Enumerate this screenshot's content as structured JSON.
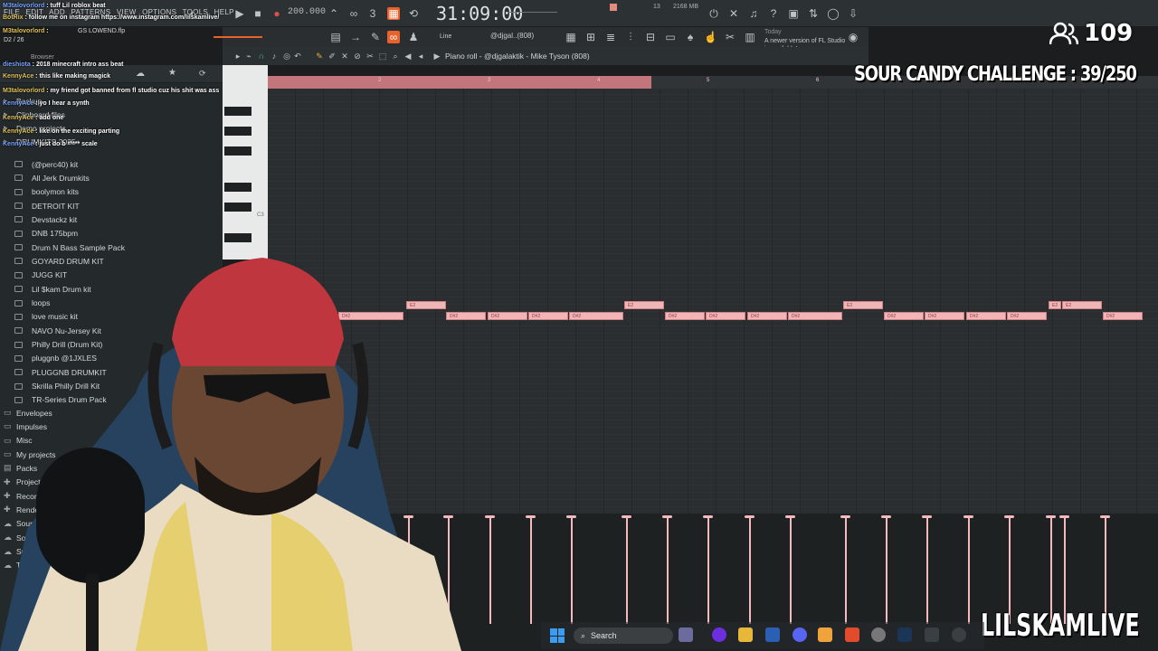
{
  "menu": [
    "FILE",
    "EDIT",
    "ADD",
    "PATTERNS",
    "VIEW",
    "OPTIONS",
    "TOOLS",
    "HELP"
  ],
  "transport": {
    "tempo": "200.000",
    "timer": "31:09:00",
    "cpu": "13",
    "memory": "2168 MB"
  },
  "update_hint": {
    "today": "Today",
    "text": "A newer version of FL Studio is available!"
  },
  "snap_mode": "Line",
  "pattern_selector": "@djgal..(808)",
  "piano_roll_title": "Piano roll - @djgalaktik - Mike Tyson (808)",
  "browser": {
    "label": "Browser",
    "top_items": [
      "Backup",
      "Clipboard files",
      "Demo projects",
      "DRUMKITS 2025+"
    ],
    "drumkits": [
      "(@perc40) kit",
      "All Jerk Drumkits",
      "boolymon kits",
      "DETROIT KIT",
      "Devstackz kit",
      "DNB 175bpm",
      "Drum N Bass Sample Pack",
      "GOYARD DRUM KIT",
      "JUGG KIT",
      "Lil $kam Drum kit",
      "loops",
      "love music kit",
      "NAVO Nu-Jersey Kit",
      "Philly Drill (Drum Kit)",
      "pluggnb @1JXLES",
      "PLUGGNB DRUMKIT",
      "Skrilla Philly Drill Kit",
      "TR-Series Drum Pack"
    ],
    "sections": [
      "Envelopes",
      "Impulses",
      "Misc",
      "My projects",
      "Packs",
      "Project bones",
      "Recorded",
      "Rendered",
      "Soundfonts",
      "Sounds",
      "Speech",
      "Templates"
    ]
  },
  "chat": [
    {
      "user": "M3talovorlord",
      "msg": "tuff Lil roblox beat"
    },
    {
      "user": "BotRix",
      "msg": "follow me on instagram https://www.instagram.com/lilskamlive/"
    },
    {
      "user": "M3talovorlord",
      "msg": ""
    },
    {
      "user": "dieshiota",
      "msg": "2018 minecraft intro ass beat"
    },
    {
      "user": "KennyAce",
      "msg": "this like making magick"
    },
    {
      "user": "M3talovorlord",
      "msg": "my friend got banned from fl studio cuz his shit was ass"
    },
    {
      "user": "KennyAce",
      "msg": "yo I hear a synth"
    },
    {
      "user": "KennyAce",
      "msg": "add one"
    },
    {
      "user": "KennyAce",
      "msg": "like on the exciting parting"
    },
    {
      "user": "KennyAce",
      "msg": "just do b ***** scale"
    }
  ],
  "playlist_file": "GS LOWEND.flp",
  "pattern_counter": "D2 / 26",
  "timeline_ticks": [
    "2",
    "3",
    "4",
    "5",
    "6"
  ],
  "note_labels": {
    "low": "D#2",
    "high": "E2"
  },
  "piano_c3": "C3",
  "overlay": {
    "viewer_count": "109",
    "challenge": "SOUR CANDY CHALLENGE : 39/250",
    "channel": "LILSKAMLIVE"
  },
  "taskbar": {
    "search_placeholder": "Search"
  },
  "colors": {
    "note": "#f0b5b7",
    "timeline_selection": "#c2767b",
    "background": "#2b2e30"
  }
}
